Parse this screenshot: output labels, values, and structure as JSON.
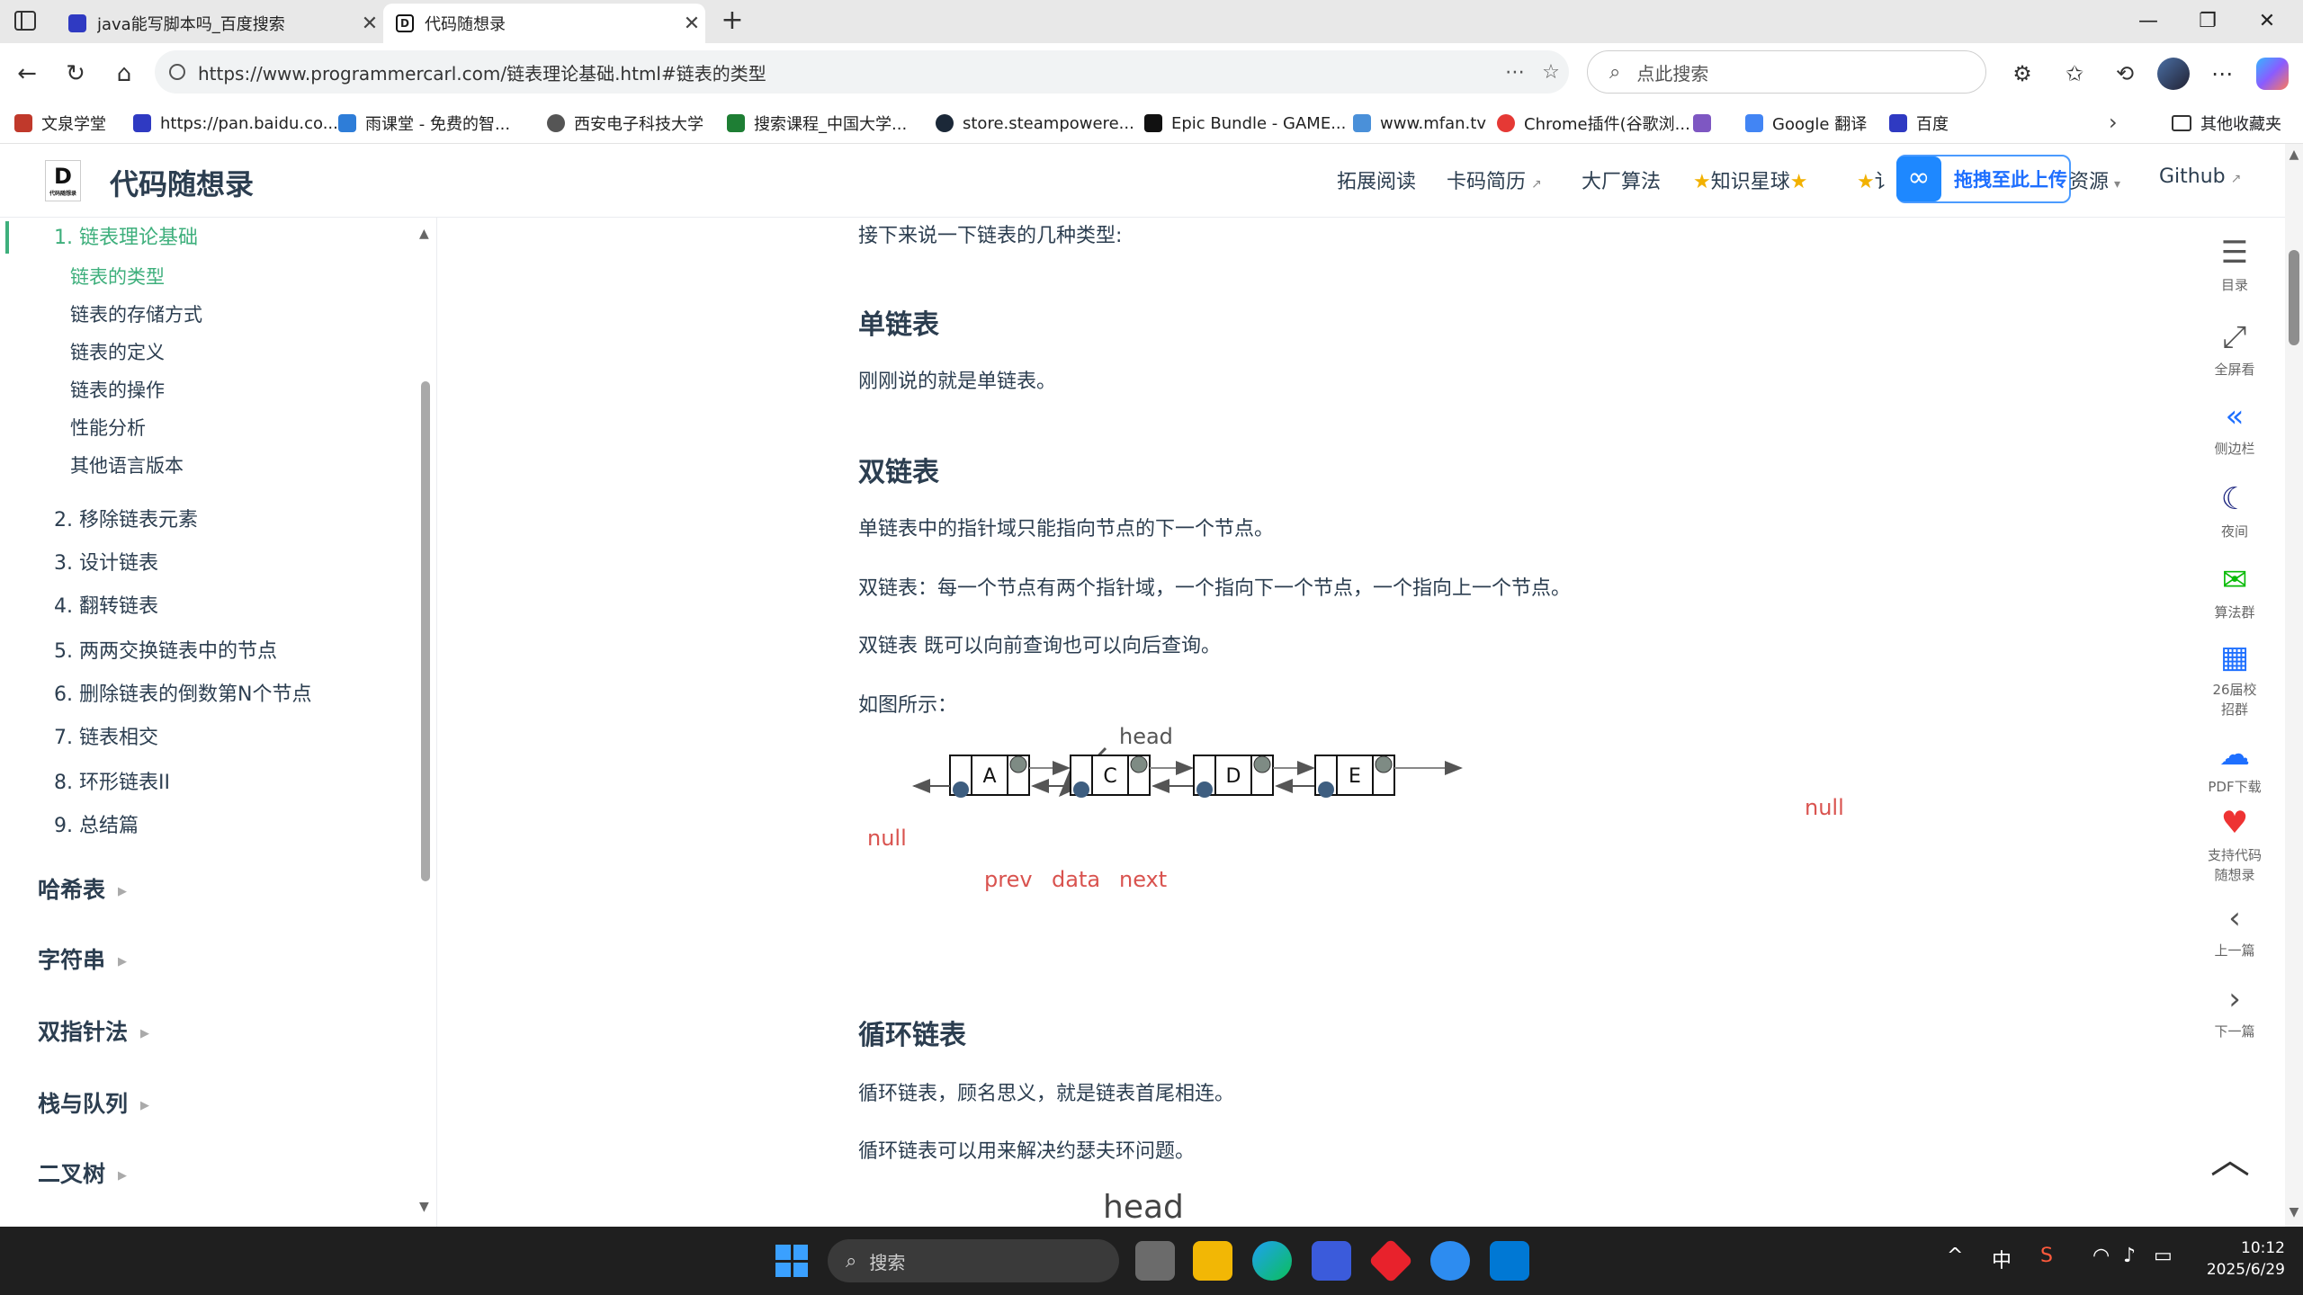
{
  "browser": {
    "tabs": [
      {
        "label": "java能写脚本吗_百度搜索",
        "active": false
      },
      {
        "label": "代码随想录",
        "active": true
      }
    ],
    "url": "https://www.programmercarl.com/链表理论基础.html#链表的类型",
    "search_placeholder": "点此搜索",
    "bookmarks": [
      "文泉学堂",
      "https://pan.baidu.co...",
      "雨课堂 - 免费的智...",
      "西安电子科技大学",
      "搜索课程_中国大学...",
      "store.steampowere...",
      "Epic Bundle - GAME...",
      "www.mfan.tv",
      "Chrome插件(谷歌浏...",
      "Google 翻译",
      "百度"
    ],
    "bookmarks_folder": "其他收藏夹"
  },
  "site": {
    "title": "代码随想录",
    "nav": [
      "拓展阅读",
      "卡码简历",
      "大厂算法",
      "知识星球",
      "讠",
      "资源",
      "Github"
    ],
    "upload_label": "拖拽至此上传"
  },
  "sidebar": {
    "current": "1. 链表理论基础",
    "subitems": [
      "链表的类型",
      "链表的存储方式",
      "链表的定义",
      "链表的操作",
      "性能分析",
      "其他语言版本"
    ],
    "items": [
      "2. 移除链表元素",
      "3. 设计链表",
      "4. 翻转链表",
      "5. 两两交换链表中的节点",
      "6. 删除链表的倒数第N个节点",
      "7. 链表相交",
      "8. 环形链表II",
      "9. 总结篇"
    ],
    "sections": [
      "哈希表",
      "字符串",
      "双指针法",
      "栈与队列",
      "二叉树"
    ]
  },
  "content": {
    "intro": "接下来说一下链表的几种类型:",
    "h_single": "单链表",
    "p_single": "刚刚说的就是单链表。",
    "h_double": "双链表",
    "p_double1": "单链表中的指针域只能指向节点的下一个节点。",
    "p_double2": "双链表：每一个节点有两个指针域，一个指向下一个节点，一个指向上一个节点。",
    "p_double3": "双链表 既可以向前查询也可以向后查询。",
    "p_figure": "如图所示：",
    "h_circular": "循环链表",
    "p_circular1": "循环链表，顾名思义，就是链表首尾相连。",
    "p_circular2": "循环链表可以用来解决约瑟夫环问题。",
    "cropped_label": "head"
  },
  "diagram": {
    "head": "head",
    "null_left": "null",
    "null_right": "null",
    "nodes": [
      "A",
      "C",
      "D",
      "E"
    ],
    "labels": {
      "prev": "prev",
      "data": "data",
      "next": "next"
    },
    "colors": {
      "label_red": "#d9534f",
      "node_dark": "#3e5e80",
      "node_gray": "#7e8b84",
      "arrow": "#555555"
    }
  },
  "right_tools": [
    {
      "icon": "list-icon",
      "label": "目录"
    },
    {
      "icon": "fullscreen-icon",
      "label": "全屏看"
    },
    {
      "icon": "double-chevron-left-icon",
      "label": "侧边栏"
    },
    {
      "icon": "moon-icon",
      "label": "夜间"
    },
    {
      "icon": "wechat-icon",
      "label": "算法群"
    },
    {
      "icon": "qr-code-icon",
      "label": "26届校招群"
    },
    {
      "icon": "cloud-download-icon",
      "label": "PDF下载"
    },
    {
      "icon": "heart-icon",
      "label": "支持代码随想录"
    },
    {
      "icon": "chevron-left-icon",
      "label": "上一篇"
    },
    {
      "icon": "chevron-right-icon",
      "label": "下一篇"
    }
  ],
  "taskbar": {
    "search_placeholder": "搜索",
    "ime": "中",
    "time": "10:12",
    "date": "2025/6/29"
  }
}
